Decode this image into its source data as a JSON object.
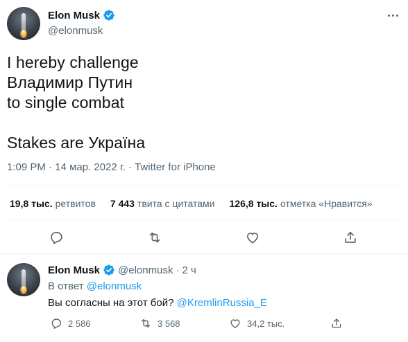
{
  "tweet": {
    "author_name": "Elon Musk",
    "author_handle": "@elonmusk",
    "text": "I hereby challenge\nВладимир Путин\nto single combat\n\nStakes are Україна",
    "time": "1:09 PM",
    "date": "14 мар. 2022 г.",
    "source": "Twitter for iPhone",
    "separator": "·",
    "stats": {
      "retweets_count": "19,8 тыс.",
      "retweets_label": "ретвитов",
      "quotes_count": "7 443",
      "quotes_label": "твита с цитатами",
      "likes_count": "126,8 тыс.",
      "likes_label": "отметка «Нравится»"
    }
  },
  "reply": {
    "author_name": "Elon Musk",
    "author_handle": "@elonmusk",
    "time_ago": "2 ч",
    "separator": "·",
    "reply_to_label": "В ответ",
    "reply_to_handle": "@elonmusk",
    "text": "Вы согласны на этот бой?",
    "mention": "@KremlinRussia_E",
    "reply_count": "2 586",
    "retweet_count": "3 568",
    "like_count": "34,2 тыс."
  },
  "colors": {
    "accent": "#1d9bf0",
    "text": "#0f1419",
    "muted": "#536471",
    "divider": "#eff3f4"
  },
  "icons": [
    "verified-badge-icon",
    "more-icon",
    "reply-icon",
    "retweet-icon",
    "like-icon",
    "share-icon"
  ]
}
